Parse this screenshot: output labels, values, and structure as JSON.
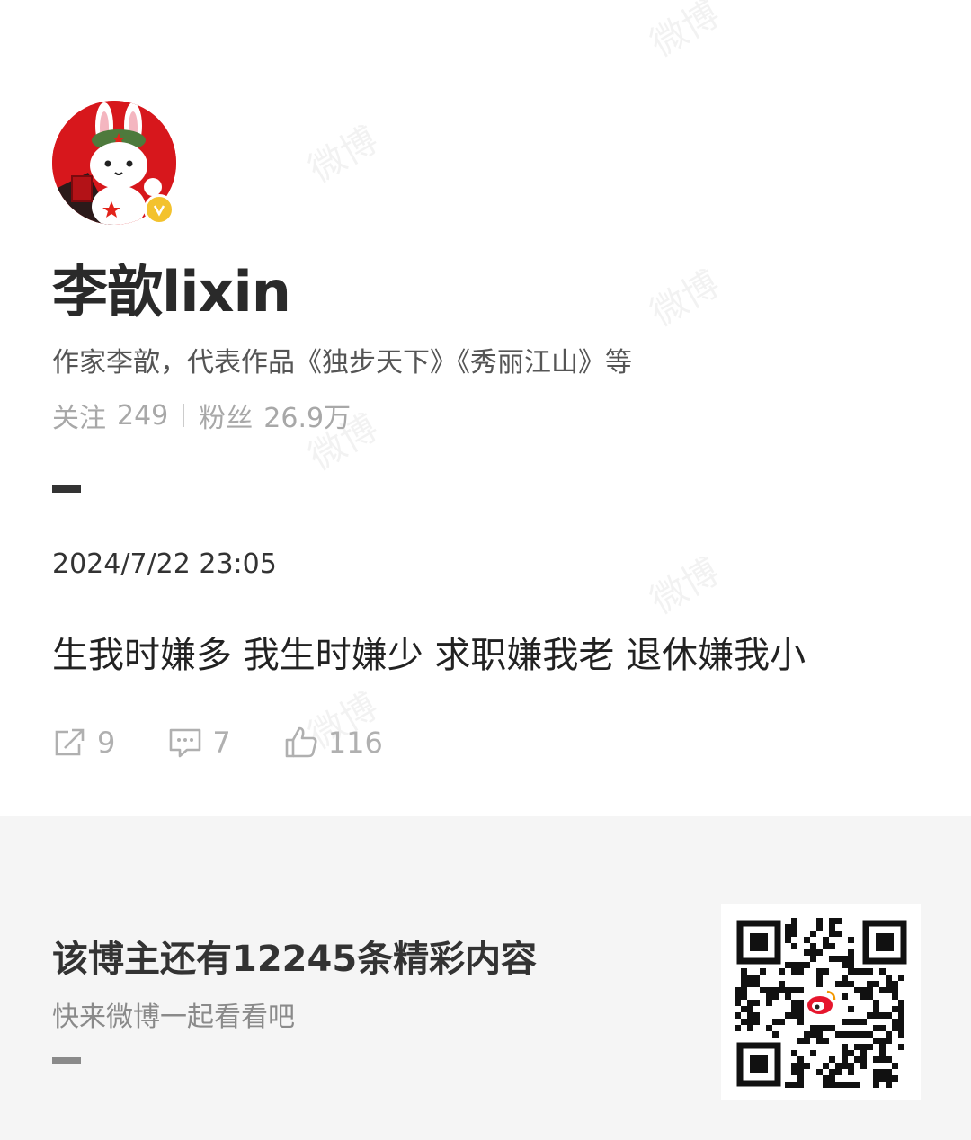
{
  "profile": {
    "name": "李歆lixin",
    "bio": "作家李歆，代表作品《独步天下》《秀丽江山》等",
    "following_label": "关注",
    "following_count": "249",
    "followers_label": "粉丝",
    "followers_count": "26.9万"
  },
  "post": {
    "datetime": "2024/7/22 23:05",
    "text": "生我时嫌多 我生时嫌少 求职嫌我老 退休嫌我小",
    "reposts": "9",
    "comments": "7",
    "likes": "116"
  },
  "promo": {
    "title": "该博主还有12245条精彩内容",
    "subtitle": "快来微博一起看看吧"
  },
  "watermark": "微博",
  "colors": {
    "avatar_red": "#d7171c",
    "verified_gold": "#f3c22d",
    "icon_gray": "#b0b0b0"
  }
}
